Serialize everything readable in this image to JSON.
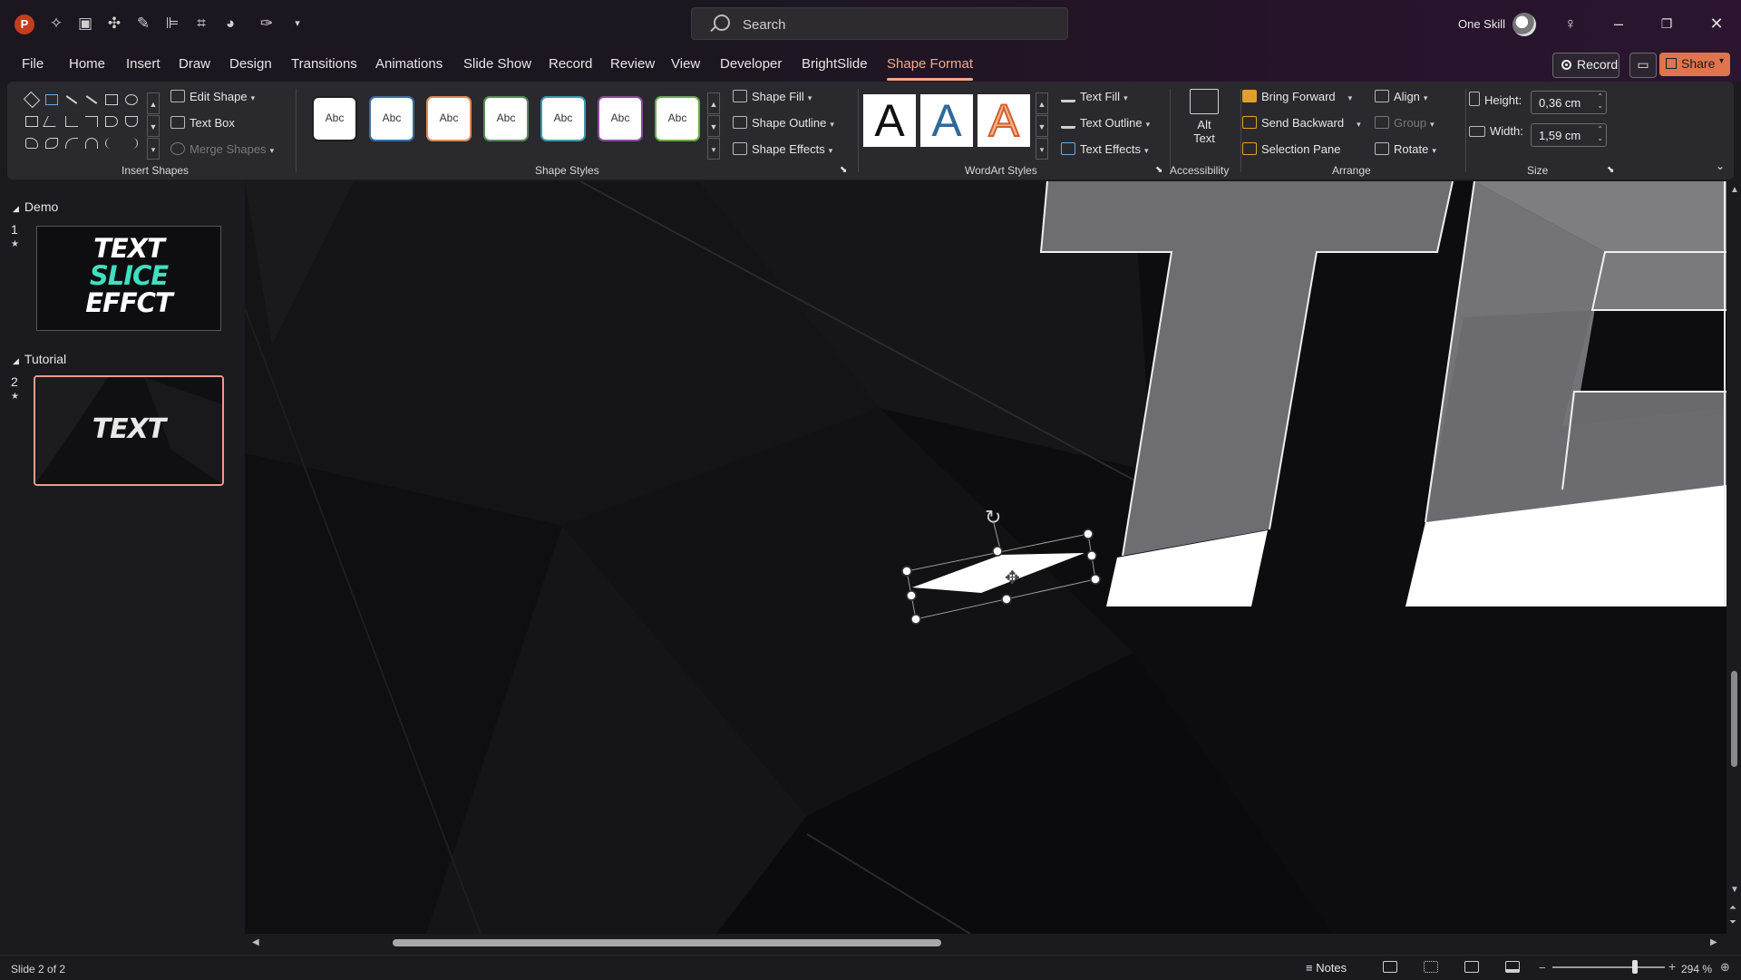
{
  "title_bar": {
    "search_placeholder": "Search",
    "user_name": "One Skill",
    "qat_icons": [
      "powerpoint-logo",
      "animation-icon",
      "picture-icon",
      "shapes-icon",
      "format-painter-icon",
      "align-icon",
      "crop-icon",
      "shape-fill-icon",
      "eyedropper-icon",
      "customize-qat-icon"
    ]
  },
  "menu": {
    "tabs": [
      "File",
      "Home",
      "Insert",
      "Draw",
      "Design",
      "Transitions",
      "Animations",
      "Slide Show",
      "Record",
      "Review",
      "View",
      "Developer",
      "BrightSlide",
      "Shape Format"
    ],
    "active_tab": "Shape Format",
    "record_label": "Record",
    "share_label": "Share"
  },
  "ribbon": {
    "insert_shapes": {
      "label": "Insert Shapes",
      "edit_shape": "Edit Shape",
      "text_box": "Text Box",
      "merge_shapes": "Merge Shapes"
    },
    "shape_styles": {
      "label": "Shape Styles",
      "preview_text": "Abc",
      "outline_colors": [
        "#1f1f1f",
        "#3a6ea5",
        "#d98b5f",
        "#5a8a5a",
        "#3a9ab0",
        "#8a4a9a",
        "#6aa84f"
      ],
      "shape_fill": "Shape Fill",
      "shape_outline": "Shape Outline",
      "shape_effects": "Shape Effects"
    },
    "wordart_styles": {
      "label": "WordArt Styles",
      "letter": "A",
      "text_fill": "Text Fill",
      "text_outline": "Text Outline",
      "text_effects": "Text Effects"
    },
    "accessibility": {
      "label": "Accessibility",
      "alt_text_line1": "Alt",
      "alt_text_line2": "Text"
    },
    "arrange": {
      "label": "Arrange",
      "bring_forward": "Bring Forward",
      "send_backward": "Send Backward",
      "selection_pane": "Selection Pane",
      "align": "Align",
      "group": "Group",
      "rotate": "Rotate"
    },
    "size": {
      "label": "Size",
      "height_label": "Height:",
      "height_value": "0,36 cm",
      "width_label": "Width:",
      "width_value": "1,59 cm"
    }
  },
  "slide_panel": {
    "sections": [
      {
        "name": "Demo",
        "slide_number": "1"
      },
      {
        "name": "Tutorial",
        "slide_number": "2"
      }
    ],
    "thumb1_lines": [
      "TEXT",
      "SLICE",
      "EFFCT"
    ],
    "thumb2_text": "TEXT"
  },
  "status_bar": {
    "slide_count": "Slide 2 of 2",
    "notes": "Notes",
    "zoom": "294 %"
  },
  "colors": {
    "accent": "#f1a98d",
    "share": "#e0744c",
    "thumb_cyan": "#3ee0c0"
  }
}
